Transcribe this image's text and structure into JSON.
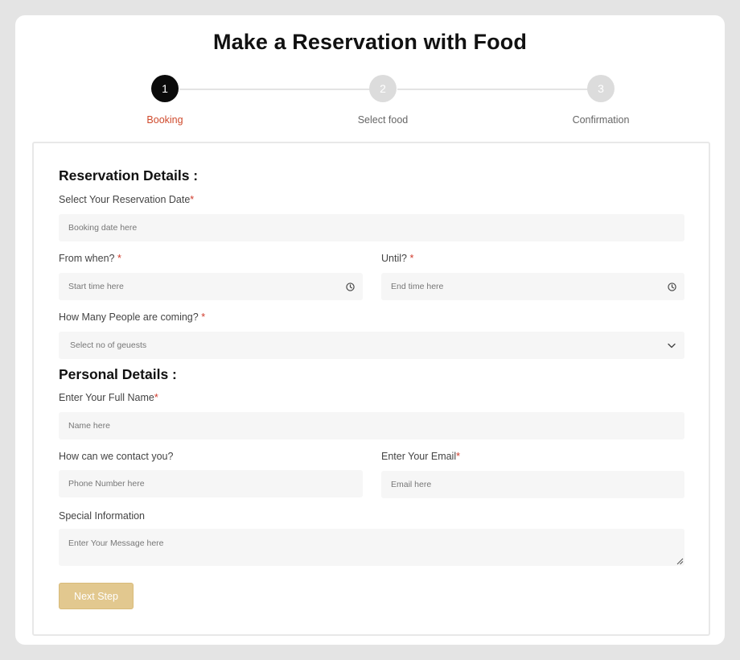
{
  "title": "Make a Reservation with Food",
  "steps": [
    {
      "number": "1",
      "label": "Booking",
      "active": true
    },
    {
      "number": "2",
      "label": "Select food",
      "active": false
    },
    {
      "number": "3",
      "label": "Confirmation",
      "active": false
    }
  ],
  "reservation": {
    "heading": "Reservation Details :",
    "date_label": "Select Your Reservation Date",
    "date_placeholder": "Booking date here",
    "from_label": "From when?",
    "from_placeholder": "Start time here",
    "until_label": "Until?",
    "until_placeholder": "End time here",
    "people_label": "How Many People are coming?",
    "people_selected": "Select no of geuests"
  },
  "personal": {
    "heading": "Personal Details :",
    "name_label": "Enter Your Full Name",
    "name_placeholder": "Name here",
    "contact_label": "How can we contact you?",
    "contact_placeholder": "Phone Number here",
    "email_label": "Enter Your Email",
    "email_placeholder": "Email here",
    "special_label": "Special Information",
    "special_placeholder": "Enter Your Message here"
  },
  "required_mark": "*",
  "next_button": "Next Step",
  "colors": {
    "accent_red": "#cf4a2c",
    "button_gold": "#e2c88f",
    "active_step": "#0b0b0b",
    "inactive_step": "#dcdcdc"
  },
  "icons": {
    "time": "clock-icon",
    "select": "chevron-down-icon",
    "textarea": "resize-handle-icon"
  }
}
